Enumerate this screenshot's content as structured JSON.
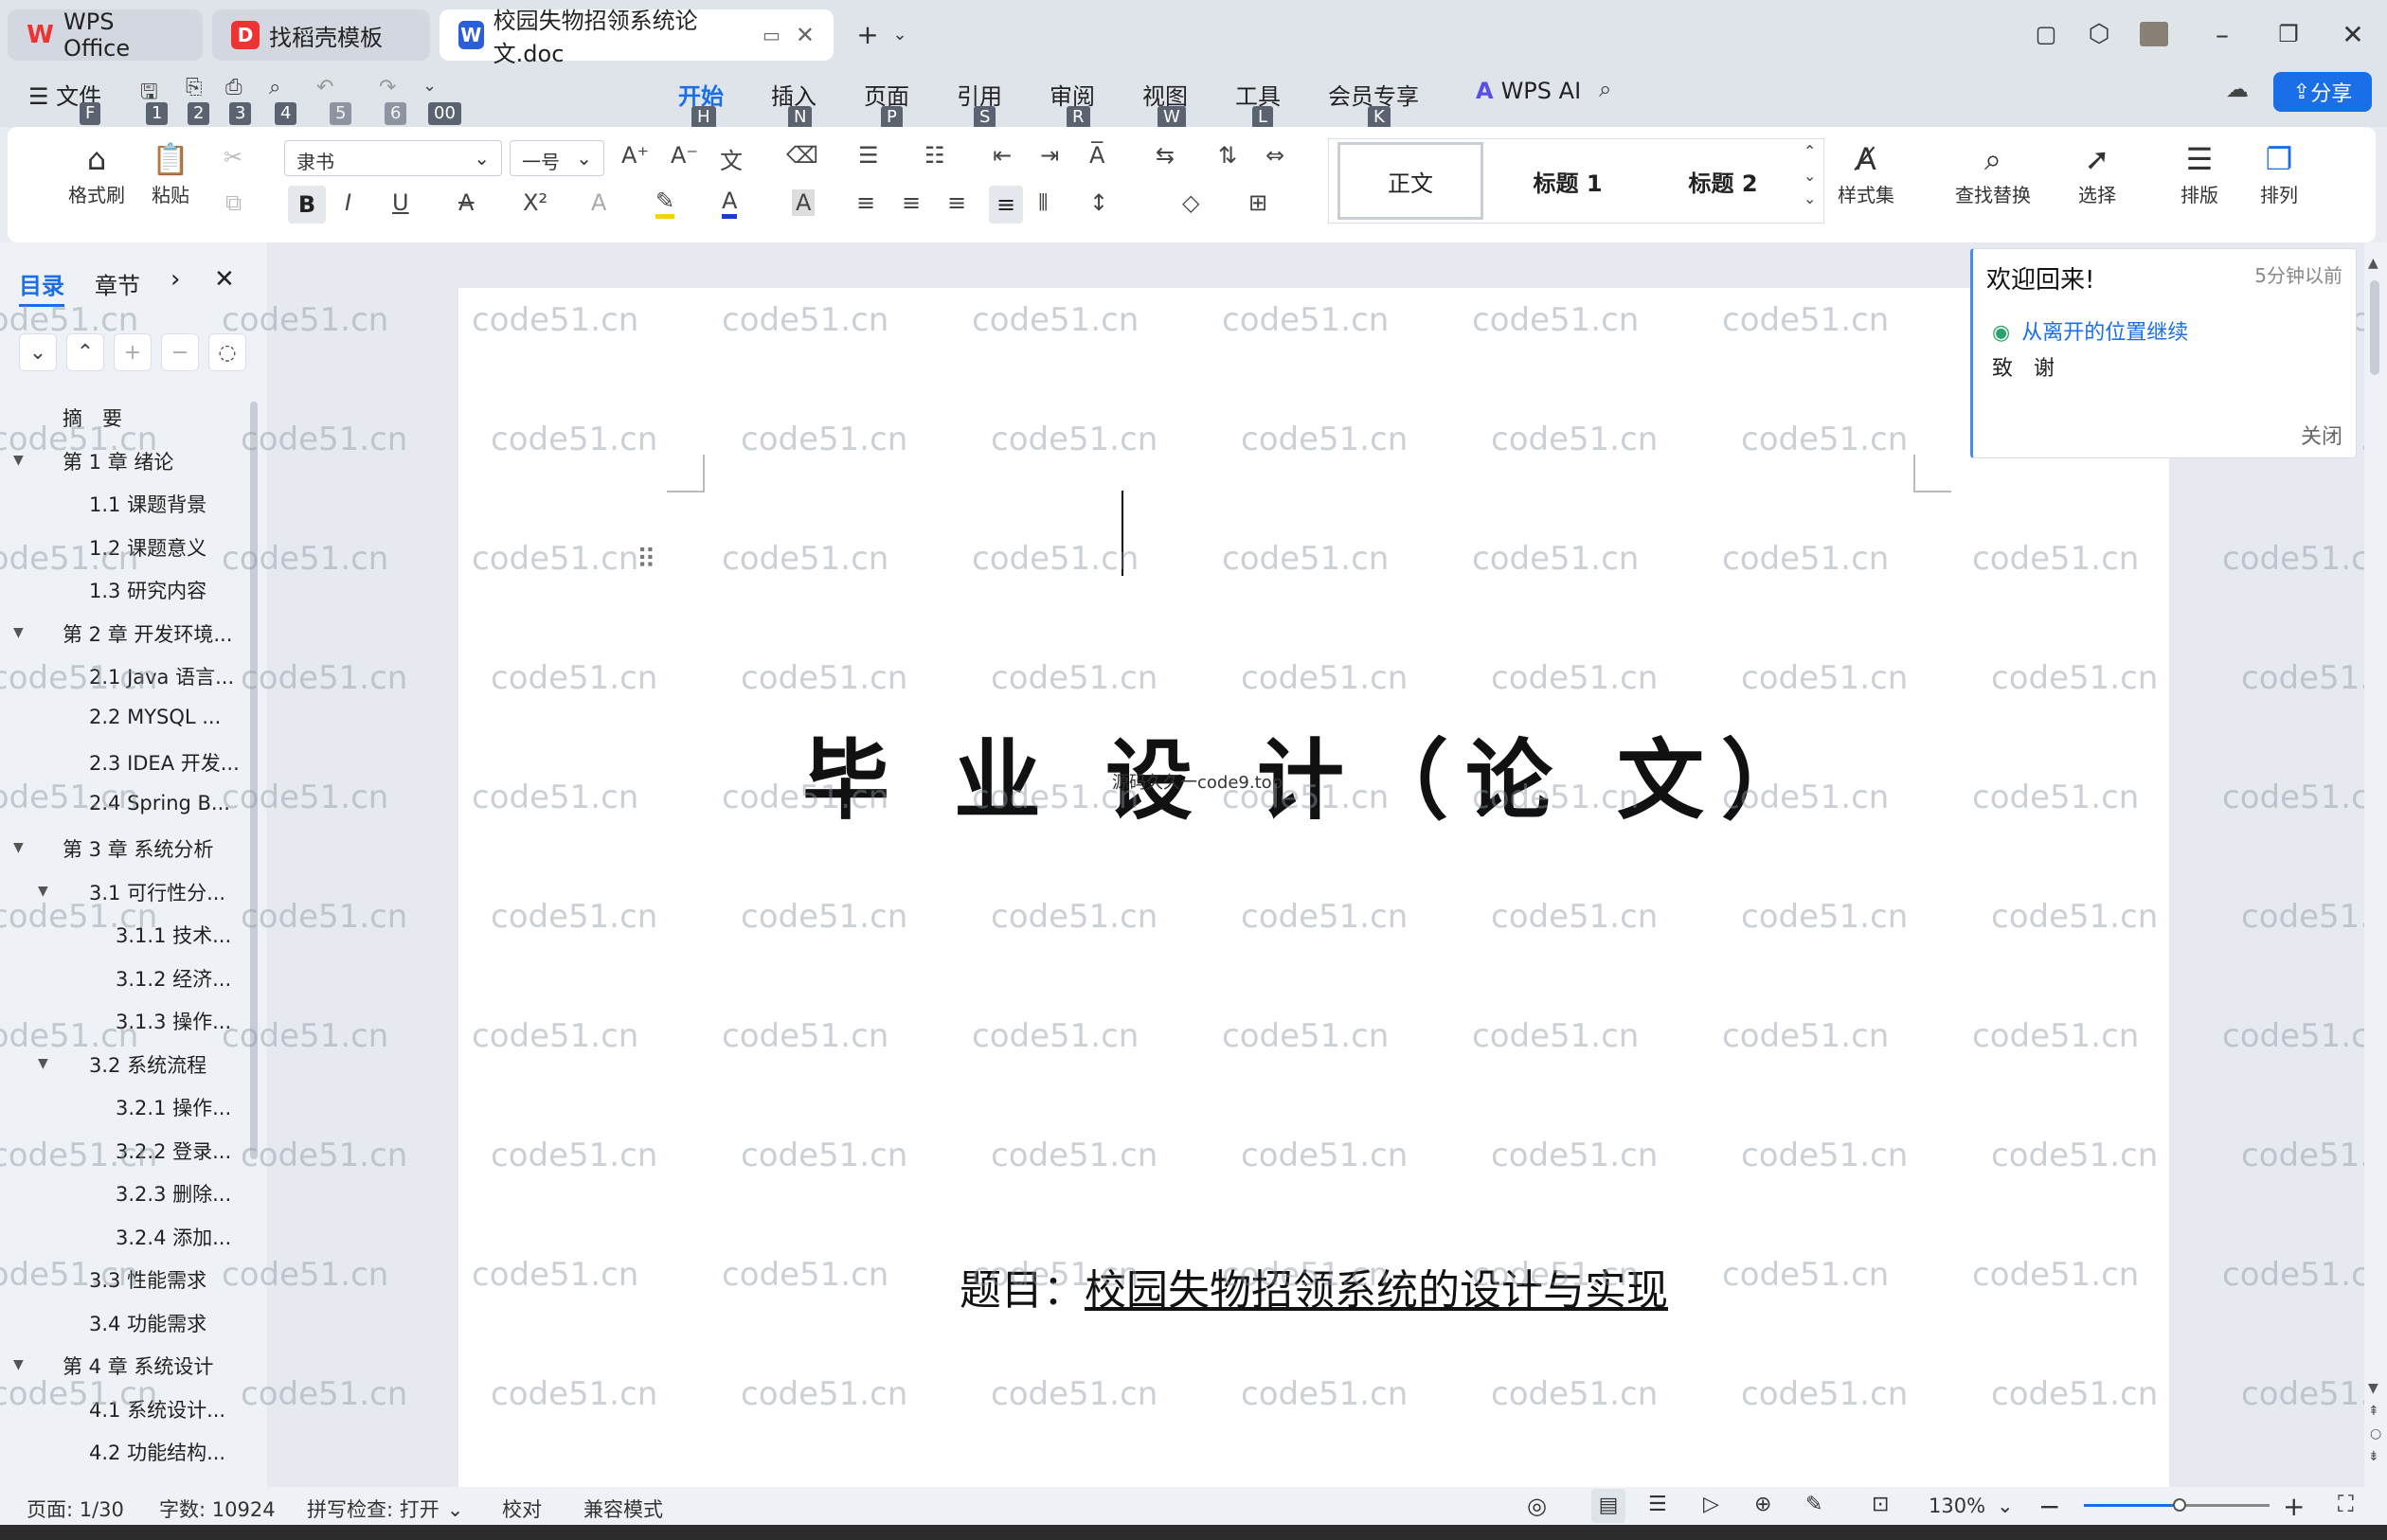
{
  "tabs": [
    {
      "label": "WPS Office",
      "icon": "W",
      "color": "#e33"
    },
    {
      "label": "找稻壳模板",
      "icon": "D",
      "color": "#e33"
    },
    {
      "label": "校园失物招领系统论文.doc",
      "icon": "W",
      "color": "#2b5fd9"
    }
  ],
  "menu": {
    "file": "文件",
    "items": [
      "开始",
      "插入",
      "页面",
      "引用",
      "审阅",
      "视图",
      "工具",
      "会员专享"
    ],
    "keys": [
      "H",
      "N",
      "P",
      "S",
      "R",
      "W",
      "L",
      "K"
    ],
    "qa_keys": [
      "F",
      "1",
      "2",
      "3",
      "4",
      "5",
      "6",
      "00"
    ],
    "wps_ai": "WPS AI",
    "share": "分享"
  },
  "ribbon": {
    "format_painter": "格式刷",
    "paste": "粘贴",
    "font": "隶书",
    "size": "一号",
    "styles": [
      "正文",
      "标题 1",
      "标题 2"
    ],
    "style_set": "样式集",
    "find_replace": "查找替换",
    "select": "选择",
    "layout": "排版",
    "arrange": "排列"
  },
  "leftpane": {
    "tab_toc": "目录",
    "tab_chapter": "章节",
    "items": [
      {
        "text": "摘　要",
        "level": 0,
        "caret": false
      },
      {
        "text": "第 1 章  绪论",
        "level": 0,
        "caret": true
      },
      {
        "text": "1.1  课题背景",
        "level": 1,
        "caret": false
      },
      {
        "text": "1.2  课题意义",
        "level": 1,
        "caret": false
      },
      {
        "text": "1.3  研究内容",
        "level": 1,
        "caret": false
      },
      {
        "text": "第 2 章  开发环境...",
        "level": 0,
        "caret": true
      },
      {
        "text": "2.1 Java 语言...",
        "level": 1,
        "caret": false
      },
      {
        "text": "2.2 MYSQL ...",
        "level": 1,
        "caret": false
      },
      {
        "text": "2.3 IDEA 开发...",
        "level": 1,
        "caret": false
      },
      {
        "text": "2.4 Spring B...",
        "level": 1,
        "caret": false
      },
      {
        "text": "第 3 章  系统分析",
        "level": 0,
        "caret": true
      },
      {
        "text": "3.1  可行性分...",
        "level": 1,
        "caret": true
      },
      {
        "text": "3.1.1  技术...",
        "level": 2,
        "caret": false
      },
      {
        "text": "3.1.2  经济...",
        "level": 2,
        "caret": false
      },
      {
        "text": "3.1.3  操作...",
        "level": 2,
        "caret": false
      },
      {
        "text": "3.2  系统流程",
        "level": 1,
        "caret": true
      },
      {
        "text": "3.2.1  操作...",
        "level": 2,
        "caret": false
      },
      {
        "text": "3.2.2  登录...",
        "level": 2,
        "caret": false
      },
      {
        "text": "3.2.3  删除...",
        "level": 2,
        "caret": false
      },
      {
        "text": "3.2.4  添加...",
        "level": 2,
        "caret": false
      },
      {
        "text": "3.3  性能需求",
        "level": 1,
        "caret": false
      },
      {
        "text": "3.4  功能需求",
        "level": 1,
        "caret": false
      },
      {
        "text": "第 4 章  系统设计",
        "level": 0,
        "caret": true
      },
      {
        "text": "4.1  系统设计...",
        "level": 1,
        "caret": false
      },
      {
        "text": "4.2  功能结构...",
        "level": 1,
        "caret": false
      }
    ]
  },
  "document": {
    "main_title": "毕 业 设 计（论 文）",
    "overlay_text": "源码久久一code9.top",
    "subject_label": "题目：",
    "subject_value": "校园失物招领系统的设计与实现",
    "watermark": "code51.cn"
  },
  "popup": {
    "title": "欢迎回来!",
    "time": "5分钟以前",
    "resume_link": "从离开的位置继续",
    "location": "致　谢",
    "close": "关闭"
  },
  "status": {
    "page": "页面: 1/30",
    "words": "字数: 10924",
    "spell": "拼写检查: 打开",
    "proof": "校对",
    "compat": "兼容模式",
    "zoom": "130%"
  },
  "colors": {
    "accent": "#1a6ee8",
    "share_bg": "#1a6ee8"
  }
}
